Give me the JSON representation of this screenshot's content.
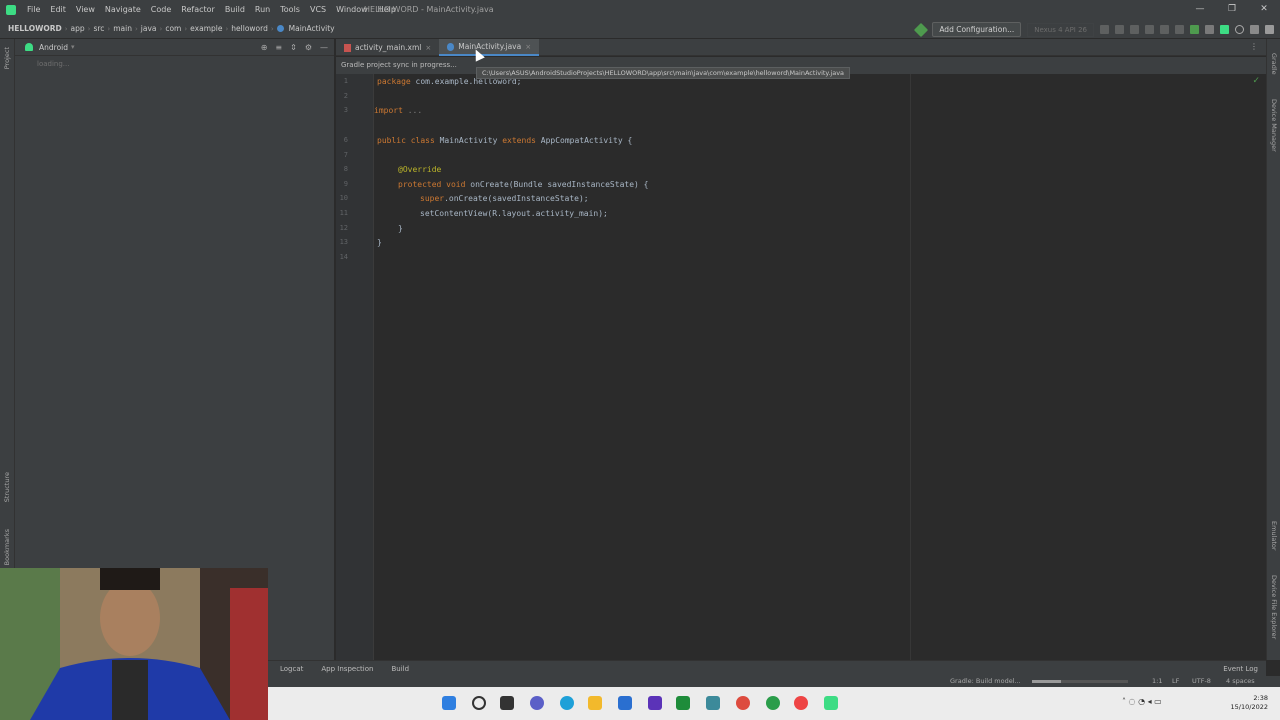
{
  "window": {
    "title": "HELLO WORD - MainActivity.java",
    "menu": [
      "File",
      "Edit",
      "View",
      "Navigate",
      "Code",
      "Refactor",
      "Build",
      "Run",
      "Tools",
      "VCS",
      "Window",
      "Help"
    ],
    "controls": [
      "—",
      "❐",
      "✕"
    ]
  },
  "breadcrumbs": [
    "HELLOWORD",
    "app",
    "src",
    "main",
    "java",
    "com",
    "example",
    "helloword",
    "MainActivity"
  ],
  "toolbar": {
    "add_configuration": "Add Configuration...",
    "device": "Nexus 4 API 26"
  },
  "project_panel": {
    "view_mode": "Android",
    "status": "loading..."
  },
  "left_stripe": [
    "Project",
    "Structure",
    "Bookmarks"
  ],
  "right_stripe": [
    "Gradle",
    "Device Manager",
    "Emulator",
    "Device File Explorer"
  ],
  "tabs": [
    {
      "label": "activity_main.xml",
      "active": false
    },
    {
      "label": "MainActivity.java",
      "active": true
    }
  ],
  "notification": "Gradle project sync in progress...",
  "tooltip_path": "C:\\Users\\ASUS\\AndroidStudioProjects\\HELLOWORD\\app\\src\\main\\java\\com\\example\\helloword\\MainActivity.java",
  "code": {
    "line_numbers": [
      "1",
      "2",
      "3",
      "6",
      "7",
      "8",
      "9",
      "10",
      "11",
      "12",
      "13",
      "14"
    ],
    "l1_kw": "package",
    "l1_rest": " com.example.helloword;",
    "l3_kw": "import",
    "l3_rest": " ...",
    "l7_a": "public class",
    "l7_b": " MainActivity ",
    "l7_c": "extends",
    "l7_d": " AppCompatActivity {",
    "l9": "@Override",
    "l10_a": "protected void",
    "l10_b": " onCreate(Bundle savedInstanceState) {",
    "l11_a": "super",
    "l11_b": ".onCreate(savedInstanceState);",
    "l12": "setContentView(R.layout.activity_main);",
    "l13": "}",
    "l14": "}"
  },
  "bottom_tools": [
    "Logcat",
    "App Inspection",
    "Build"
  ],
  "event_log": "Event Log",
  "status": {
    "gradle": "Gradle: Build model...",
    "position": "1:1",
    "line_sep": "LF",
    "encoding": "UTF-8",
    "indent": "4 spaces"
  },
  "clock": {
    "time": "2:38",
    "date": "15/10/2022"
  },
  "colors": {
    "android_green": "#3ddc84",
    "keyword": "#cc7832",
    "annotation": "#bbb529",
    "identifier": "#a9b7c6"
  }
}
